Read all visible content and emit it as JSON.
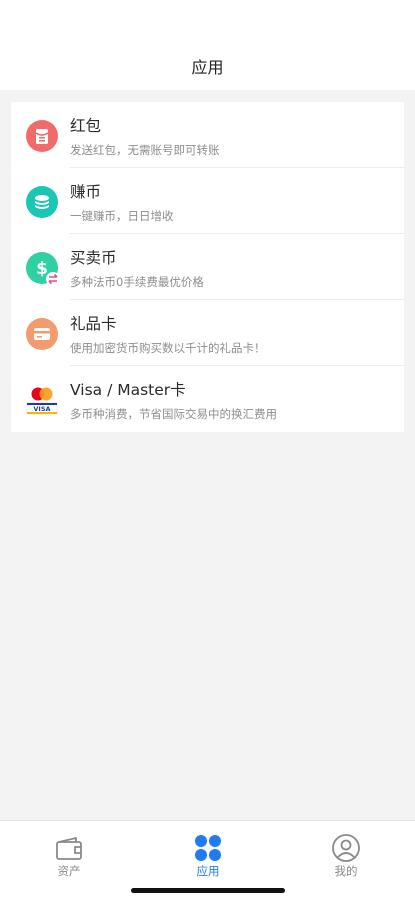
{
  "header": {
    "title": "应用"
  },
  "apps": [
    {
      "name": "红包",
      "desc": "发送红包，无需账号即可转账",
      "icon": "red-packet-icon",
      "color": "#f26b6b"
    },
    {
      "name": "赚币",
      "desc": "一键赚币，日日增收",
      "icon": "earn-coin-icon",
      "color": "#1cc6b5"
    },
    {
      "name": "买卖币",
      "desc": "多种法币0手续费最优价格",
      "icon": "buy-sell-coin-icon",
      "color": "#2fd1a3"
    },
    {
      "name": "礼品卡",
      "desc": "使用加密货币购买数以千计的礼品卡！",
      "icon": "gift-card-icon",
      "color": "#f39a6e"
    },
    {
      "name": "Visa / Master卡",
      "desc": "多币种消费，节省国际交易中的换汇费用",
      "icon": "visa-mastercard-icon",
      "color": "#1a3f9b"
    }
  ],
  "tabbar": {
    "items": [
      {
        "label": "资产",
        "icon": "wallet-icon",
        "active": false
      },
      {
        "label": "应用",
        "icon": "apps-grid-icon",
        "active": true
      },
      {
        "label": "我的",
        "icon": "profile-icon",
        "active": false
      }
    ],
    "active_color": "#1e7bf0",
    "inactive_color": "#8a8a8a"
  }
}
